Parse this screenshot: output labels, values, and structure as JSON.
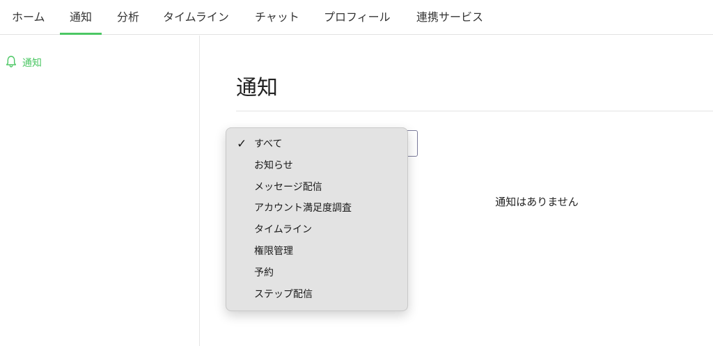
{
  "topnav": {
    "tabs": [
      {
        "label": "ホーム"
      },
      {
        "label": "通知"
      },
      {
        "label": "分析"
      },
      {
        "label": "タイムライン"
      },
      {
        "label": "チャット"
      },
      {
        "label": "プロフィール"
      },
      {
        "label": "連携サービス"
      }
    ],
    "active_tab": "通知"
  },
  "sidebar": {
    "items": [
      {
        "label": "通知",
        "icon": "bell-icon"
      }
    ]
  },
  "main": {
    "title": "通知",
    "empty_message": "通知はありません"
  },
  "filter_dropdown": {
    "selected": "すべて",
    "options": [
      {
        "label": "すべて"
      },
      {
        "label": "お知らせ"
      },
      {
        "label": "メッセージ配信"
      },
      {
        "label": "アカウント満足度調査"
      },
      {
        "label": "タイムライン"
      },
      {
        "label": "権限管理"
      },
      {
        "label": "予約"
      },
      {
        "label": "ステップ配信"
      }
    ]
  },
  "colors": {
    "accent": "#4cc764",
    "text": "#222222",
    "dropdown_bg": "#e3e3e3"
  }
}
